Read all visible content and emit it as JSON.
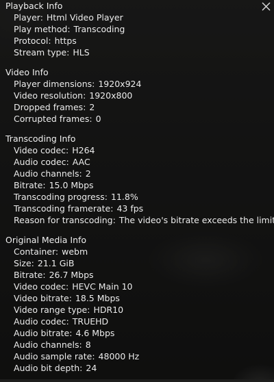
{
  "sections": [
    {
      "title": "Playback Info",
      "rows": [
        {
          "label": "Player",
          "value": "Html Video Player"
        },
        {
          "label": "Play method",
          "value": "Transcoding"
        },
        {
          "label": "Protocol",
          "value": "https"
        },
        {
          "label": "Stream type",
          "value": "HLS"
        }
      ]
    },
    {
      "title": "Video Info",
      "rows": [
        {
          "label": "Player dimensions",
          "value": "1920x924"
        },
        {
          "label": "Video resolution",
          "value": "1920x800"
        },
        {
          "label": "Dropped frames",
          "value": "2"
        },
        {
          "label": "Corrupted frames",
          "value": "0"
        }
      ]
    },
    {
      "title": "Transcoding Info",
      "rows": [
        {
          "label": "Video codec",
          "value": "H264"
        },
        {
          "label": "Audio codec",
          "value": "AAC"
        },
        {
          "label": "Audio channels",
          "value": "2"
        },
        {
          "label": "Bitrate",
          "value": "15.0 Mbps"
        },
        {
          "label": "Transcoding progress",
          "value": "11.8%"
        },
        {
          "label": "Transcoding framerate",
          "value": "43 fps"
        },
        {
          "label": "Reason for transcoding",
          "value": "The video's bitrate exceeds the limit"
        }
      ]
    },
    {
      "title": "Original Media Info",
      "rows": [
        {
          "label": "Container",
          "value": "webm"
        },
        {
          "label": "Size",
          "value": "21.1 GiB"
        },
        {
          "label": "Bitrate",
          "value": "26.7 Mbps"
        },
        {
          "label": "Video codec",
          "value": "HEVC Main 10"
        },
        {
          "label": "Video bitrate",
          "value": "18.5 Mbps"
        },
        {
          "label": "Video range type",
          "value": "HDR10"
        },
        {
          "label": "Audio codec",
          "value": "TRUEHD"
        },
        {
          "label": "Audio bitrate",
          "value": "4.6 Mbps"
        },
        {
          "label": "Audio channels",
          "value": "8"
        },
        {
          "label": "Audio sample rate",
          "value": "48000 Hz"
        },
        {
          "label": "Audio bit depth",
          "value": "24"
        }
      ]
    }
  ],
  "close_icon": "close-icon",
  "colors": {
    "text": "#e6e6e6",
    "overlay": "#000000"
  }
}
